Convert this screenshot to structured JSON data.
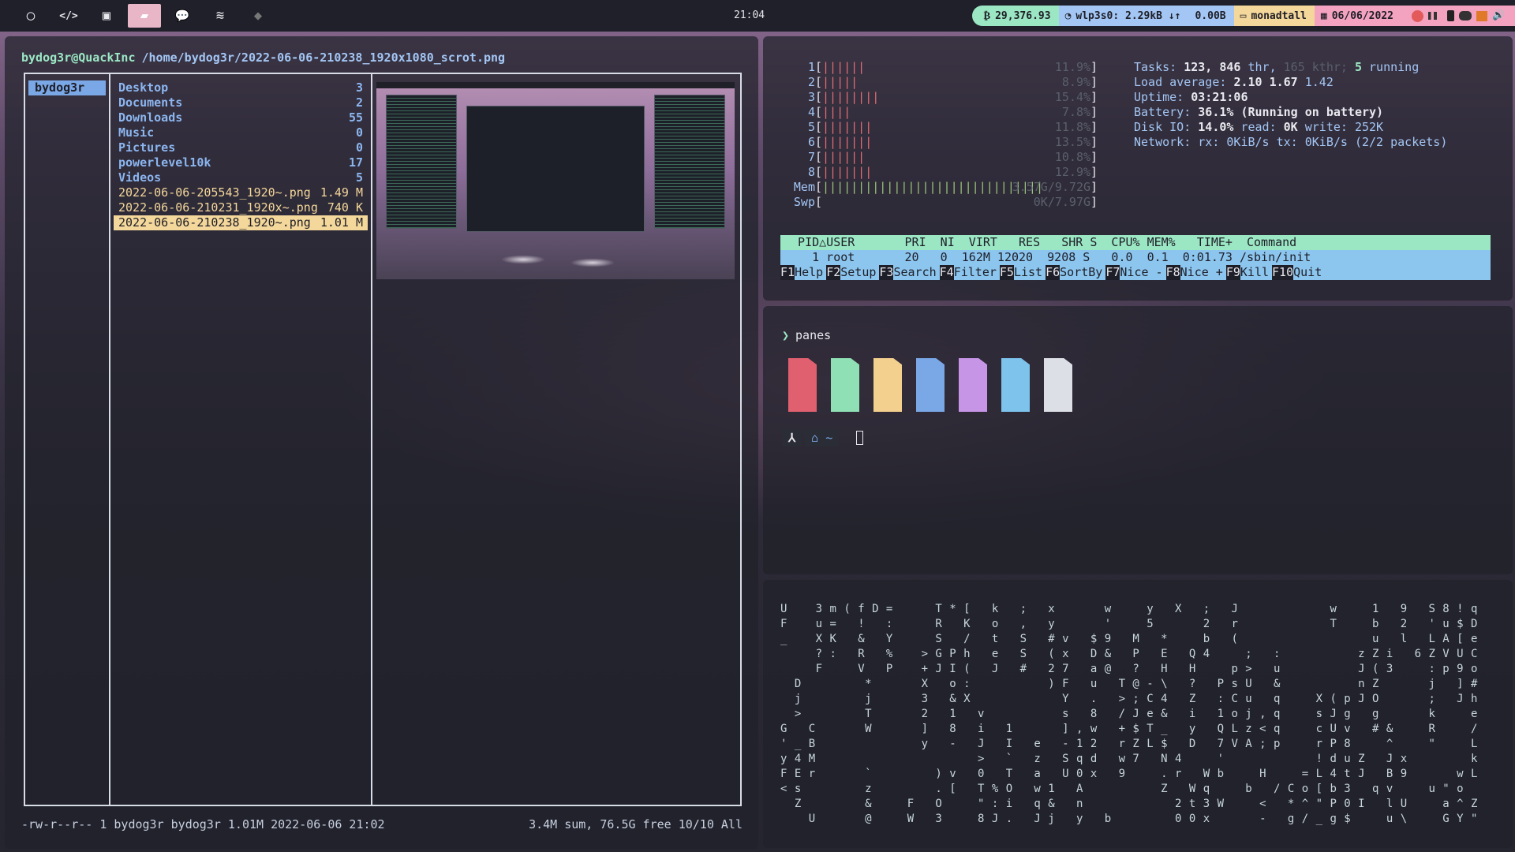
{
  "bar": {
    "launchers": [
      {
        "icon": "circle-logo-icon",
        "glyph": "◯"
      },
      {
        "icon": "code-icon",
        "glyph": "</>"
      },
      {
        "icon": "terminal-icon",
        "glyph": "▣"
      },
      {
        "icon": "folder-icon",
        "glyph": "▰"
      },
      {
        "icon": "chat-icon",
        "glyph": "💬"
      },
      {
        "icon": "spotify-icon",
        "glyph": "≋"
      },
      {
        "icon": "layers-icon",
        "glyph": "◆"
      }
    ],
    "clock": "21:04",
    "btc": "29,376.93",
    "net_iface": "wlp3s0:",
    "net_rate": "2.29kB",
    "net_arrows": "↓↑",
    "io": "0.00B",
    "user": "monadtall",
    "date": "06/06/2022"
  },
  "ranger": {
    "host": "bydog3r@QuackInc",
    "path": "/home/bydog3r/2022-06-06-210238_1920x1080_scrot.png",
    "parent": "bydog3r",
    "entries": [
      {
        "name": "Desktop",
        "size": "3",
        "kind": "dir"
      },
      {
        "name": "Documents",
        "size": "2",
        "kind": "dir"
      },
      {
        "name": "Downloads",
        "size": "55",
        "kind": "dir"
      },
      {
        "name": "Music",
        "size": "0",
        "kind": "dir"
      },
      {
        "name": "Pictures",
        "size": "0",
        "kind": "dir"
      },
      {
        "name": "powerlevel10k",
        "size": "17",
        "kind": "dir"
      },
      {
        "name": "Videos",
        "size": "5",
        "kind": "dir"
      },
      {
        "name": "2022-06-06-205543_1920~.png",
        "size": "1.49 M",
        "kind": "file"
      },
      {
        "name": "2022-06-06-210231_1920x~.png",
        "size": "740 K",
        "kind": "file"
      },
      {
        "name": "2022-06-06-210238_1920~.png",
        "size": "1.01 M",
        "kind": "sel"
      }
    ],
    "status_left": "-rw-r--r-- 1 bydog3r bydog3r 1.01M 2022-06-06 21:02",
    "status_right": "3.4M sum, 76.5G free  10/10  All"
  },
  "htop": {
    "cpus": [
      {
        "n": "1",
        "bars": "||||||",
        "pct": "11.9%"
      },
      {
        "n": "2",
        "bars": "|||||",
        "pct": "8.9%"
      },
      {
        "n": "3",
        "bars": "||||||||",
        "pct": "15.4%"
      },
      {
        "n": "4",
        "bars": "||||",
        "pct": "7.8%"
      },
      {
        "n": "5",
        "bars": "|||||||",
        "pct": "11.8%"
      },
      {
        "n": "6",
        "bars": "|||||||",
        "pct": "13.5%"
      },
      {
        "n": "7",
        "bars": "||||||",
        "pct": "10.8%"
      },
      {
        "n": "8",
        "bars": "|||||||",
        "pct": "12.9%"
      }
    ],
    "mem_label": "Mem",
    "mem_bars": "||||||||||||||||||||||||||||||||||||",
    "mem_val": "3.57G/9.72G",
    "swp_label": "Swp",
    "swp_val": "0K/7.97G",
    "tasks_label": "Tasks:",
    "tasks_val": "123,",
    "thr_val": "846",
    "thr_label": "thr,",
    "kthr": "165 kthr;",
    "running_val": "5",
    "running_label": "running",
    "load_label": "Load average:",
    "load1": "2.10",
    "load5": "1.67",
    "load15": "1.42",
    "uptime_label": "Uptime:",
    "uptime_val": "03:21:06",
    "battery_label": "Battery:",
    "battery_val": "36.1% (Running on battery)",
    "disk_label": "Disk IO:",
    "disk_pct": "14.0%",
    "disk_read_label": "read:",
    "disk_read": "0K",
    "disk_write_label": "write:",
    "disk_write": "252K",
    "netw_label": "Network:",
    "netw_val": "rx: 0KiB/s tx: 0KiB/s (2/2 packets)",
    "header": "  PID△USER       PRI  NI  VIRT   RES   SHR S  CPU% MEM%   TIME+  Command",
    "proc": "    1 root       20   0  162M 12020  9208 S   0.0  0.1  0:01.73 /sbin/init",
    "fkeys": [
      {
        "k": "F1",
        "l": "Help"
      },
      {
        "k": "F2",
        "l": "Setup"
      },
      {
        "k": "F3",
        "l": "Search"
      },
      {
        "k": "F4",
        "l": "Filter"
      },
      {
        "k": "F5",
        "l": "List"
      },
      {
        "k": "F6",
        "l": "SortBy"
      },
      {
        "k": "F7",
        "l": "Nice -"
      },
      {
        "k": "F8",
        "l": "Nice +"
      },
      {
        "k": "F9",
        "l": "Kill"
      },
      {
        "k": "F10",
        "l": "Quit"
      }
    ]
  },
  "shell": {
    "prompt_arrow": "❯",
    "command": "panes",
    "swatch_colors": [
      "#e06070",
      "#8fe0b4",
      "#f4d08e",
      "#7aa7e6",
      "#c795e6",
      "#7ec3ec",
      "#dcdfe6"
    ],
    "seg1": "⅄",
    "seg2": "⌂ ~"
  },
  "matrix": {
    "lines": [
      "U    3 m ( f D =      T * [   k   ;   x       w     y   X   ;   J             w     1   9   S 8 ! q",
      "F    u =   !   :      R   K   o   ,   y       '     5       2   r             T     b   2   ' u $ D",
      "_    X K   &   Y      S   /   t   S   # v   $ 9   M   *     b   (                   u   l   L A [ e",
      "     ? :   R   %    > G P h   e   S   ( x   D &   P   E   Q 4     ;   :           z Z i   6 Z V U C",
      "     F     V   P    + J I (   J   #   2 7   a @   ?   H   H     p >   u           J ( 3     : p 9 o",
      "  D         *       X   o :           ) F   u   T @ - \\   ?   P s U   &           n Z       j   ] #",
      "  j         j       3   & X             Y   .   > ; C 4   Z   : C u   q     X ( p J O       ;   J h",
      "  >         T       2   1   v           s   8   / J e &   i   1 o j , q     s J g   g       k     e",
      "G   C       W       ]   8   i   1       ] , w   + $ T _   y   Q L z < q     c U v   # &     R     /",
      "' _ B               y   -   J   I   e   - 1 2   r Z L $   D   7 V A ; p     r P 8     ^     \"     L",
      "y 4 M                       >   `   z   S q d   w 7   N 4     '             ! d u Z   J x         k",
      "F E r       `         ) v   0   T   a   U 0 x   9     . r   W b     H     = L 4 t J   B 9       w L",
      "< s         z         . [   T % O   w 1   A           Z   W q     b   / C o [ b 3   q v     u \" o",
      "  Z         &     F   O     \" : i   q &   n             2 t 3 W     <   * ^ \" P 0 I   l U     a ^ Z",
      "    U       @     W   3     8 J .   J j   y   b         0 0 x       -   g / _ g $     u \\     G Y \""
    ]
  }
}
